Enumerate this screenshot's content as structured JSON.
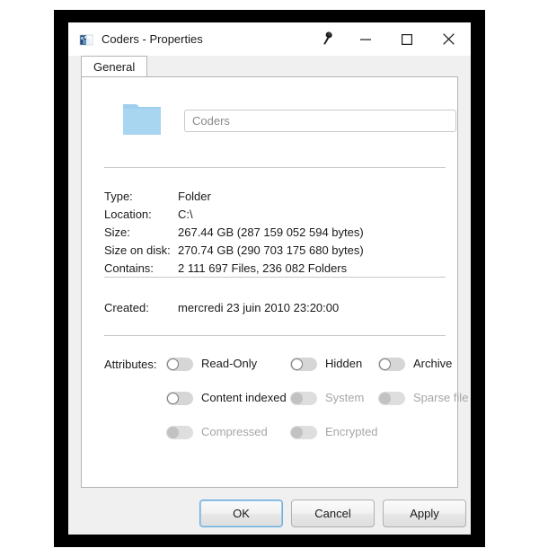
{
  "window": {
    "title": "Coders - Properties",
    "icon": "folder-image-icon",
    "pin_icon": "pushpin-icon",
    "controls": {
      "minimize": "minimize-icon",
      "maximize": "maximize-icon",
      "close": "close-icon"
    }
  },
  "tabs": [
    {
      "label": "General",
      "selected": true
    }
  ],
  "header": {
    "folder_icon": "folder-icon",
    "name_value": "Coders",
    "name_placeholder": "Coders"
  },
  "info": [
    {
      "label": "Type:",
      "value": "Folder"
    },
    {
      "label": "Location:",
      "value": "C:\\"
    },
    {
      "label": "Size:",
      "value": "267.44 GB (287 159 052 594 bytes)"
    },
    {
      "label": "Size on disk:",
      "value": "270.74 GB (290 703 175 680 bytes)"
    },
    {
      "label": "Contains:",
      "value": "2 111 697 Files, 236 082 Folders"
    }
  ],
  "created": {
    "label": "Created:",
    "value": "mercredi 23 juin 2010 23:20:00"
  },
  "attributes": {
    "label": "Attributes:",
    "items": [
      {
        "name": "read-only",
        "label": "Read-Only",
        "checked": false,
        "enabled": true
      },
      {
        "name": "hidden",
        "label": "Hidden",
        "checked": false,
        "enabled": true
      },
      {
        "name": "archive",
        "label": "Archive",
        "checked": false,
        "enabled": true
      },
      {
        "name": "content-indexed",
        "label": "Content indexed",
        "checked": false,
        "enabled": true
      },
      {
        "name": "system",
        "label": "System",
        "checked": false,
        "enabled": false
      },
      {
        "name": "sparse-file",
        "label": "Sparse file",
        "checked": false,
        "enabled": false
      },
      {
        "name": "compressed",
        "label": "Compressed",
        "checked": false,
        "enabled": false
      },
      {
        "name": "encrypted",
        "label": "Encrypted",
        "checked": false,
        "enabled": false
      }
    ]
  },
  "footer": {
    "ok": "OK",
    "cancel": "Cancel",
    "apply": "Apply"
  },
  "colors": {
    "folder": "#9ed0ee",
    "toggle_track": "#d6d6d6",
    "toggle_track_disabled": "#dedede",
    "focus_border": "#6faddc",
    "dialog_bg": "#f0f0f0",
    "panel_bg": "#ffffff",
    "frame": "#000000"
  }
}
